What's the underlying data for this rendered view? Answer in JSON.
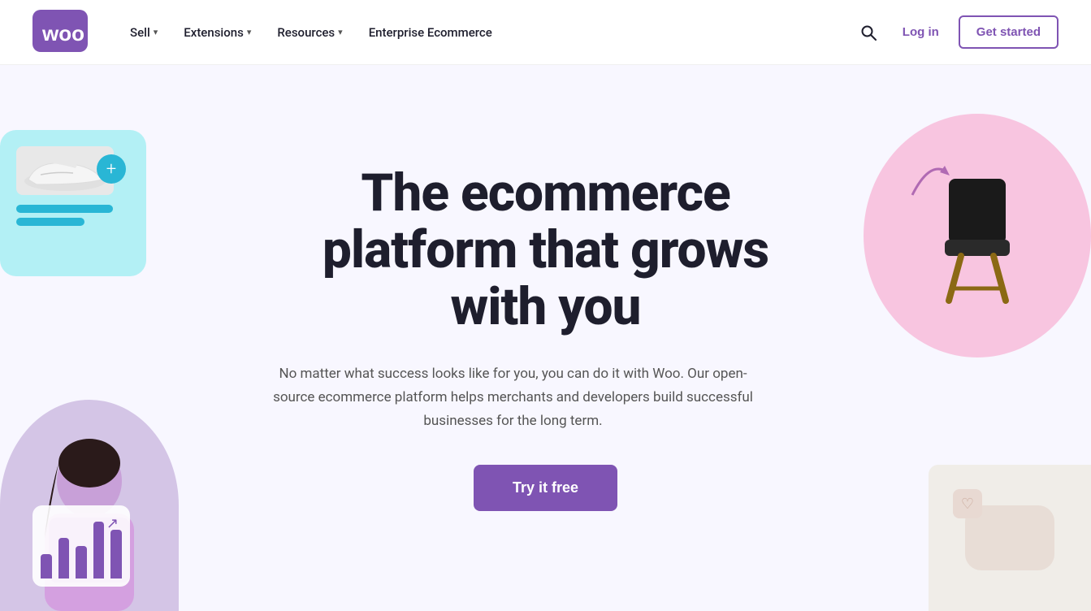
{
  "header": {
    "logo_text": "Woo",
    "nav": {
      "sell_label": "Sell",
      "extensions_label": "Extensions",
      "resources_label": "Resources",
      "enterprise_label": "Enterprise Ecommerce"
    },
    "actions": {
      "search_aria": "Search",
      "login_label": "Log in",
      "get_started_label": "Get started"
    }
  },
  "hero": {
    "title": "The ecommerce platform that grows with you",
    "subtitle": "No matter what success looks like for you, you can do it with Woo. Our open-source ecommerce platform helps merchants and developers build successful businesses for the long term.",
    "cta_label": "Try it free"
  },
  "colors": {
    "brand_purple": "#7f54b3",
    "brand_light_bg": "#f8f7ff",
    "teal": "#29b6d5",
    "pink": "#f8c5e0"
  }
}
